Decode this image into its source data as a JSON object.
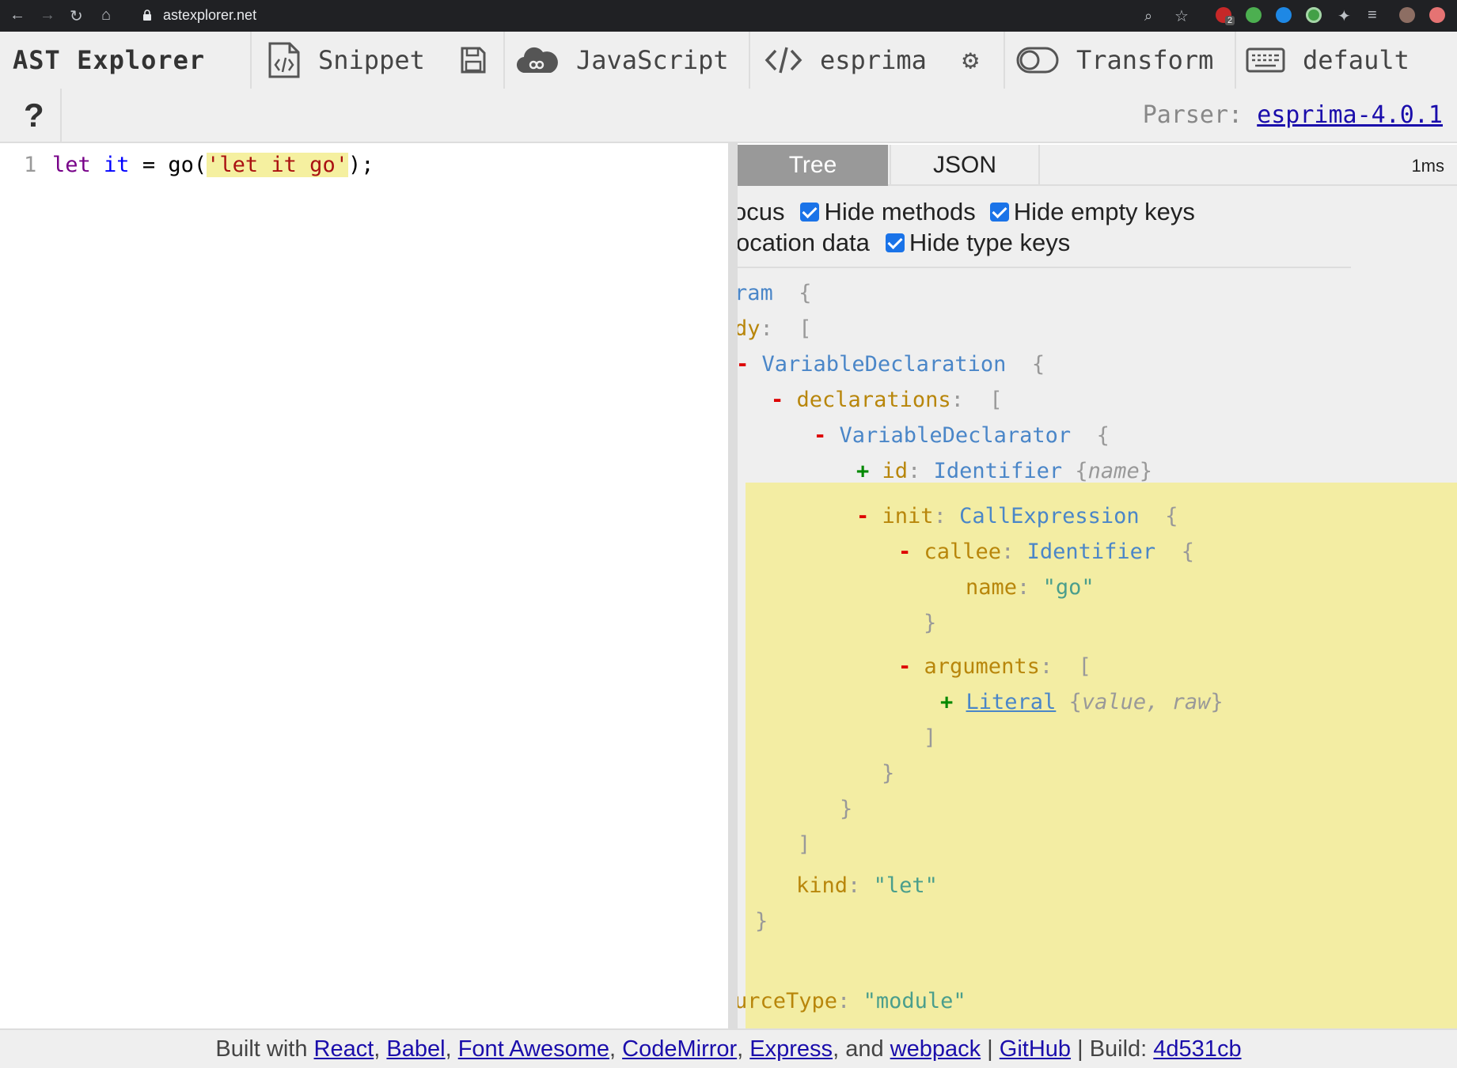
{
  "browser": {
    "url": "astexplorer.net",
    "ext_badge": "2"
  },
  "toolbar": {
    "brand": "AST Explorer",
    "snippet_label": "Snippet",
    "language_label": "JavaScript",
    "parser_label": "esprima",
    "transform_label": "Transform",
    "keymap_label": "default",
    "help_label": "?",
    "parser_info_prefix": "Parser:",
    "parser_version": "esprima-4.0.1"
  },
  "editor": {
    "line_number": "1",
    "code": {
      "kw": "let",
      "var": "it",
      "eq": "=",
      "fn": "go(",
      "str": "'let it go'",
      "end": ");"
    }
  },
  "output": {
    "tabs": [
      "Tree",
      "JSON"
    ],
    "timing": "1ms",
    "options": {
      "row1_cut": "ocus",
      "hide_methods": "Hide methods",
      "hide_empty_keys": "Hide empty keys",
      "row2_cut": "ocation data",
      "hide_type_keys": "Hide type keys"
    },
    "tree": {
      "program": "ram",
      "body": "dy",
      "variable_declaration": "VariableDeclaration",
      "declarations": "declarations",
      "variable_declarator": "VariableDeclarator",
      "id_key": "id",
      "identifier_type": "Identifier",
      "id_fields": "name",
      "init_key": "init",
      "call_expression": "CallExpression",
      "callee_key": "callee",
      "callee_type": "Identifier",
      "name_key": "name",
      "name_value": "\"go\"",
      "arguments_key": "arguments",
      "literal_type": "Literal",
      "literal_fields": "value, raw",
      "kind_key": "kind",
      "kind_value": "\"let\"",
      "source_type_key": "urceType",
      "source_type_value": "\"module\""
    }
  },
  "footer": {
    "built_with": "Built with",
    "links": [
      "React",
      "Babel",
      "Font Awesome",
      "CodeMirror",
      "Express",
      "webpack"
    ],
    "and": "and",
    "github": "GitHub",
    "build_label": "Build:",
    "build_hash": "4d531cb"
  }
}
